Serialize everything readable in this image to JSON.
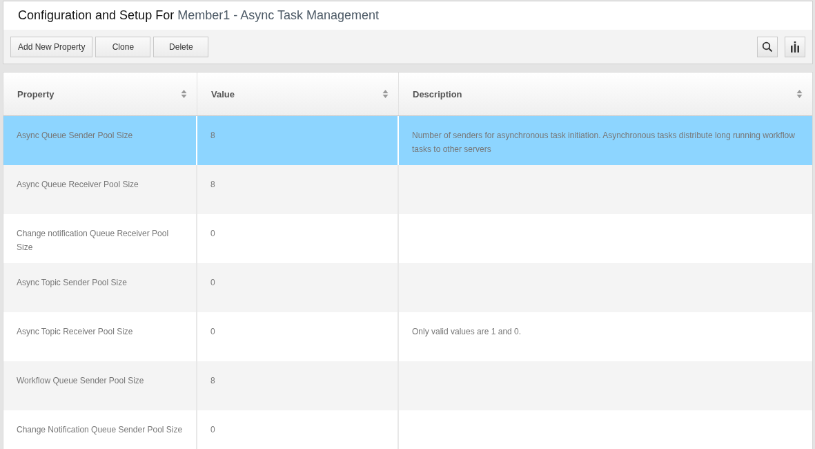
{
  "header": {
    "title": "Configuration and Setup For",
    "subtitle": "Member1 - Async Task Management"
  },
  "toolbar": {
    "buttons": [
      "Add New Property",
      "Clone",
      "Delete"
    ]
  },
  "table": {
    "columns": [
      "Property",
      "Value",
      "Description"
    ],
    "rows": [
      {
        "property": "Async Queue Sender Pool Size",
        "value": "8",
        "description": "Number of senders for asynchronous task initiation. Asynchronous tasks distribute long running workflow tasks to other servers",
        "selected": true
      },
      {
        "property": "Async Queue Receiver Pool Size",
        "value": "8",
        "selected": false
      },
      {
        "property": "Change notification Queue Receiver Pool Size",
        "value": "0",
        "selected": false
      },
      {
        "property": "Async Topic Sender Pool Size",
        "value": "0",
        "selected": false
      },
      {
        "property": "Async Topic Receiver Pool Size",
        "value": "0",
        "description": "Only valid values are 1 and 0.",
        "selected": false
      },
      {
        "property": "Workflow Queue Sender Pool Size",
        "value": "8",
        "selected": false
      },
      {
        "property": "Change Notification Queue Sender Pool Size",
        "value": "0",
        "selected": false
      }
    ]
  }
}
